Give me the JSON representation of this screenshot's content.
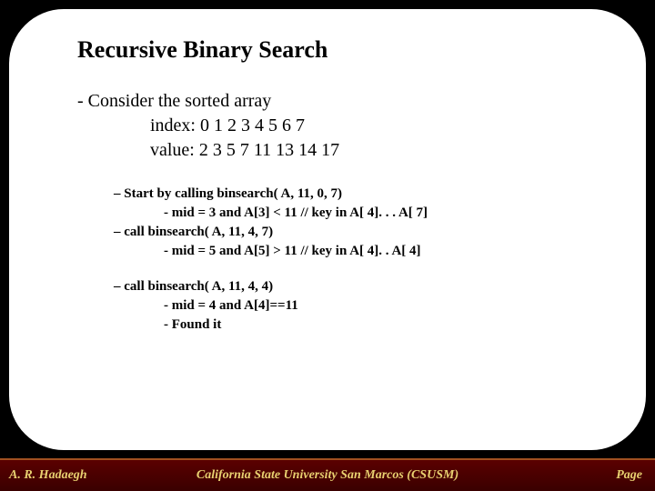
{
  "title": "Recursive Binary Search",
  "intro": {
    "line1": "- Consider the sorted array",
    "line2": "index: 0 1 2 3   4   5   6   7",
    "line3": "value: 2 3 5 7 11 13 14 17"
  },
  "steps": {
    "b1l1": "– Start by calling binsearch( A, 11, 0, 7)",
    "b1l2": "- mid = 3 and A[3] < 11 // key in A[ 4]. . . A[ 7]",
    "b1l3": "– call binsearch( A, 11, 4, 7)",
    "b1l4": "- mid = 5 and A[5] > 11 // key in A[ 4]. . A[ 4]",
    "b2l1": "– call binsearch( A, 11, 4, 4)",
    "b2l2": "- mid = 4 and A[4]==11",
    "b2l3": "- Found it"
  },
  "footer": {
    "author": "A. R. Hadaegh",
    "university": "California State University San Marcos (CSUSM)",
    "page": "Page"
  }
}
